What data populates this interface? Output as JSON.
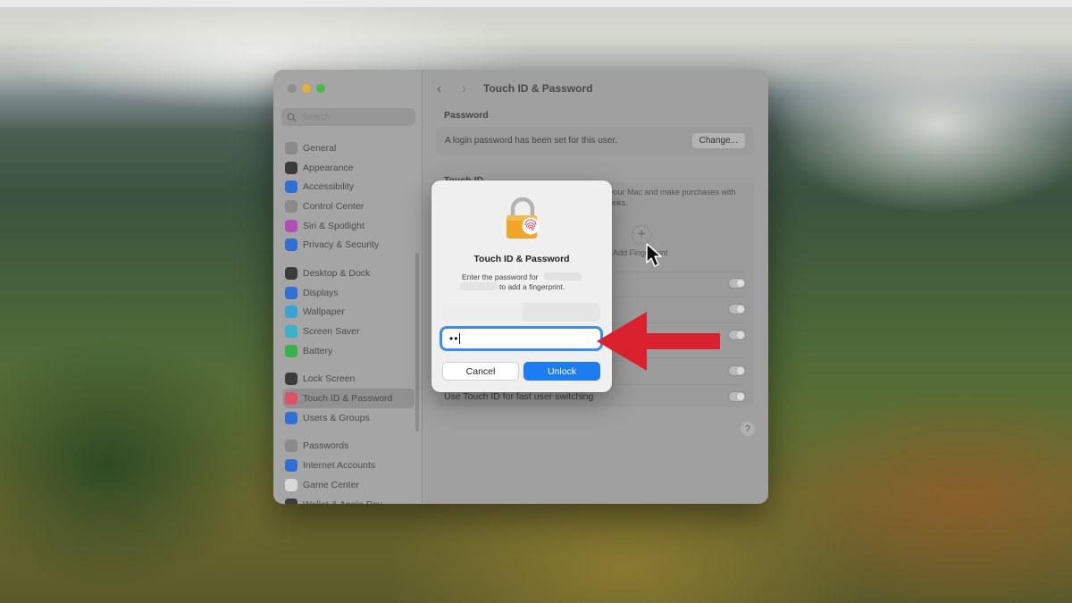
{
  "window": {
    "title": "Touch ID & Password"
  },
  "search": {
    "placeholder": "Search"
  },
  "sidebar": {
    "items": [
      {
        "label": "General",
        "icon": "gear-icon",
        "color": "#8a8a8a"
      },
      {
        "label": "Appearance",
        "icon": "appearance-icon",
        "color": "#3b3b3b"
      },
      {
        "label": "Accessibility",
        "icon": "accessibility-icon",
        "color": "#2f6fd6"
      },
      {
        "label": "Control Center",
        "icon": "control-center-icon",
        "color": "#8a8a8a"
      },
      {
        "label": "Siri & Spotlight",
        "icon": "siri-icon",
        "color": "#b04fb8"
      },
      {
        "label": "Privacy & Security",
        "icon": "hand-icon",
        "color": "#2f6fd6"
      },
      {
        "label": "Desktop & Dock",
        "icon": "desktop-icon",
        "color": "#3b3b3b"
      },
      {
        "label": "Displays",
        "icon": "displays-icon",
        "color": "#2f6fd6"
      },
      {
        "label": "Wallpaper",
        "icon": "wallpaper-icon",
        "color": "#3aa2d8"
      },
      {
        "label": "Screen Saver",
        "icon": "screen-saver-icon",
        "color": "#3bb0c8"
      },
      {
        "label": "Battery",
        "icon": "battery-icon",
        "color": "#3ab04a"
      },
      {
        "label": "Lock Screen",
        "icon": "lock-screen-icon",
        "color": "#3b3b3b"
      },
      {
        "label": "Touch ID & Password",
        "icon": "fingerprint-icon",
        "color": "#e0506a"
      },
      {
        "label": "Users & Groups",
        "icon": "users-icon",
        "color": "#2f6fd6"
      },
      {
        "label": "Passwords",
        "icon": "key-icon",
        "color": "#8a8a8a"
      },
      {
        "label": "Internet Accounts",
        "icon": "at-icon",
        "color": "#2f6fd6"
      },
      {
        "label": "Game Center",
        "icon": "game-center-icon",
        "color": "#d8d8d8"
      },
      {
        "label": "Wallet & Apple Pay",
        "icon": "wallet-icon",
        "color": "#3b3b3b"
      }
    ]
  },
  "main": {
    "password_section": "Password",
    "password_status": "A login password has been set for this user.",
    "change_button": "Change...",
    "touchid_section": "Touch ID",
    "touchid_desc": "k your Mac and make purchases with",
    "touchid_desc2": "Books.",
    "add_fingerprint_label": "Add Fingerprint",
    "last_row": "Use Touch ID for fast user switching"
  },
  "dialog": {
    "title": "Touch ID & Password",
    "message_part1": "Enter the password for",
    "message_part2": "to add a fingerprint.",
    "password_value": "••",
    "cancel_label": "Cancel",
    "unlock_label": "Unlock"
  },
  "colors": {
    "accent": "#1e7cf1",
    "annotation_arrow": "#d9222e",
    "focus_ring": "#3d8bf0"
  }
}
